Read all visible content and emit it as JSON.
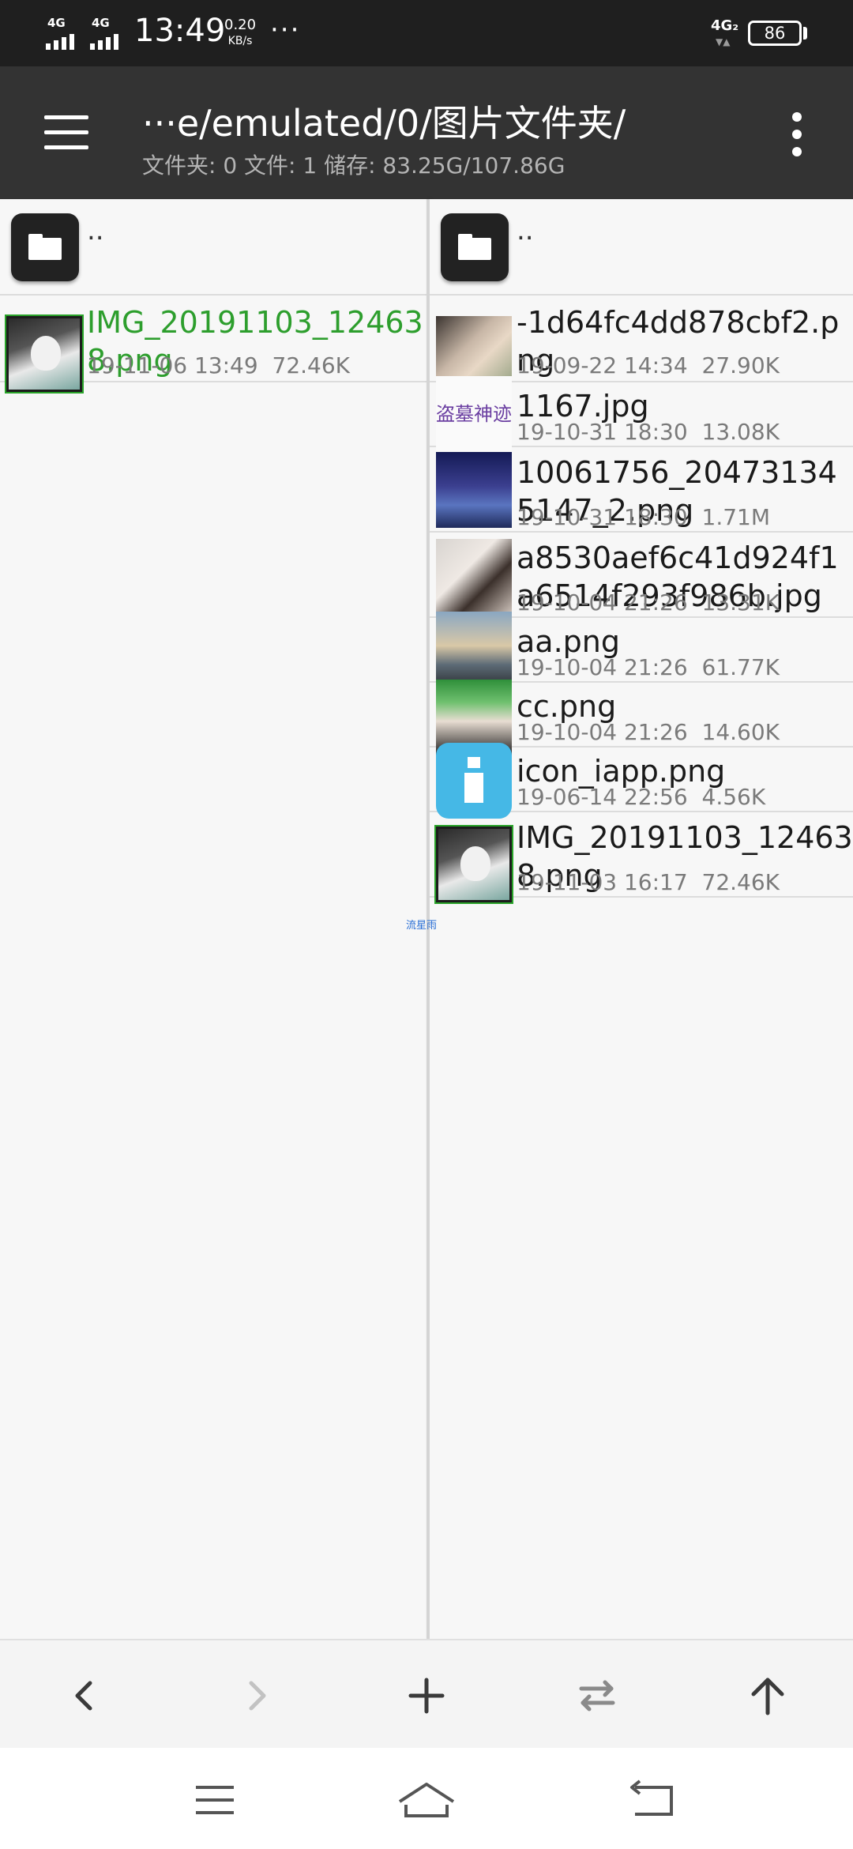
{
  "status_bar": {
    "signal1": "4G",
    "signal2": "4G",
    "time": "13:49",
    "speed_value": "0.20",
    "speed_unit": "KB/s",
    "more": "···",
    "network": "4G₂",
    "battery": "86"
  },
  "header": {
    "path": "···e/emulated/0/图片文件夹/",
    "summary": "文件夹: 0  文件: 1  储存: 83.25G/107.86G"
  },
  "left_pane": {
    "parent_label": "..",
    "files": [
      {
        "name": "IMG_20191103_124638.png",
        "date": "19-11-06 13:49",
        "size": "72.46K",
        "thumb": "anime"
      }
    ]
  },
  "right_pane": {
    "parent_label": "..",
    "files": [
      {
        "name": "-1d64fc4dd878cbf2.png",
        "date": "19-09-22 14:34",
        "size": "27.90K",
        "thumb": "couple"
      },
      {
        "name": "1167.jpg",
        "date": "19-10-31 18:30",
        "size": "13.08K",
        "thumb": "text",
        "thumb_text": "盗墓神迹"
      },
      {
        "name": "10061756_204731345147_2.png",
        "date": "19-10-31 18:30",
        "size": "1.71M",
        "thumb": "sky"
      },
      {
        "name": "a8530aef6c41d924f1a6514f293f986b.jpg",
        "date": "19-10-04 21:26",
        "size": "13.31K",
        "thumb": "girl"
      },
      {
        "name": "aa.png",
        "date": "19-10-04 21:26",
        "size": "61.77K",
        "thumb": "sunset"
      },
      {
        "name": "cc.png",
        "date": "19-10-04 21:26",
        "size": "14.60K",
        "thumb": "cc"
      },
      {
        "name": "icon_iapp.png",
        "date": "19-06-14 22:56",
        "size": "4.56K",
        "thumb": "iapp"
      },
      {
        "name": "IMG_20191103_124638.png",
        "date": "19-11-03 16:17",
        "size": "72.46K",
        "thumb": "anime"
      }
    ]
  },
  "floating_tag": "流星雨",
  "toolbar": {
    "icons": [
      "back-icon",
      "forward-icon",
      "add-icon",
      "swap-icon",
      "up-icon"
    ]
  },
  "navbar": {
    "icons": [
      "recents-icon",
      "home-icon",
      "nav-back-icon"
    ]
  },
  "colors": {
    "header_bg": "#333333",
    "status_bg": "#1f1f1f",
    "selected_text": "#2d9e2d",
    "meta_text": "#7a7a7a"
  }
}
